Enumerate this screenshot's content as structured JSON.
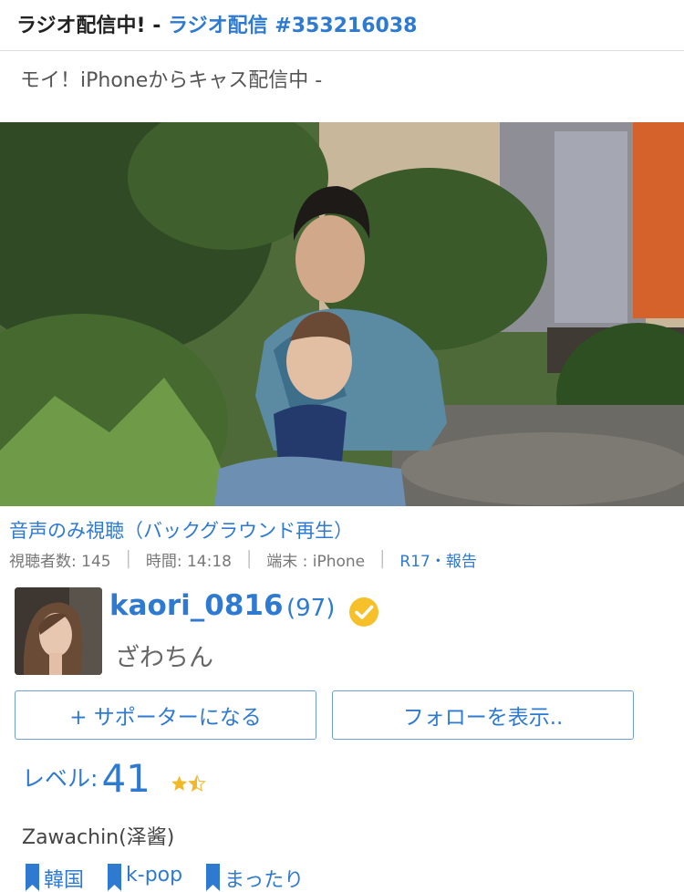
{
  "header": {
    "title_prefix": "ラジオ配信中! - ",
    "title_link": "ラジオ配信 #353216038"
  },
  "broadcast": {
    "subtitle": "モイ！iPhoneからキャス配信中 -"
  },
  "listen_link": "音声のみ視聴（バックグラウンド再生）",
  "stats": {
    "viewers": "視聴者数: 145",
    "time": "時間: 14:18",
    "device": "端末 : iPhone",
    "report": "R17・報告"
  },
  "profile": {
    "username": "kaori_0816",
    "count": "(97)",
    "display_name": "ざわちん",
    "verified_color": "#f5c02a"
  },
  "buttons": {
    "support": "+ サポーターになる",
    "follow": "フォローを表示.."
  },
  "level": {
    "label": "レベル:",
    "value": "41",
    "stars": 1.5,
    "star_color": "#f0b92a"
  },
  "bio": "Zawachin(泽酱)",
  "tags": [
    "韓国",
    "k-pop",
    "まったり"
  ],
  "colors": {
    "accent": "#2f7ad1",
    "text": "#333333"
  }
}
